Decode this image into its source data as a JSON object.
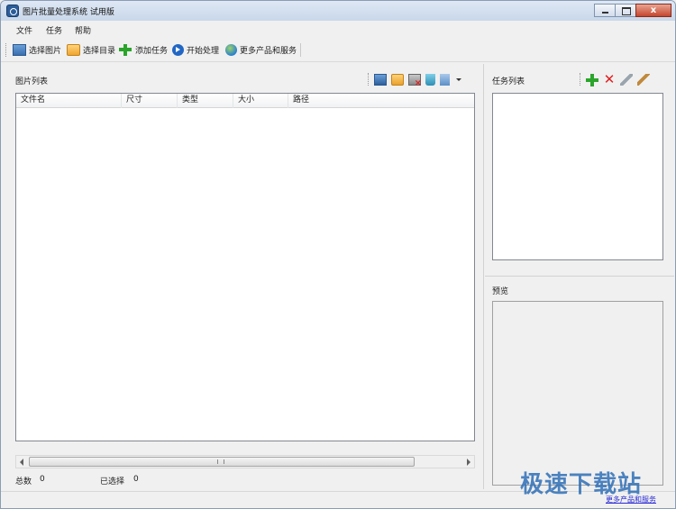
{
  "window": {
    "title": "图片批量处理系统 试用版",
    "controls": {
      "minimize": "",
      "maximize": "",
      "close": "x"
    }
  },
  "menu": [
    "文件",
    "任务",
    "帮助"
  ],
  "toolbar": {
    "items": [
      {
        "label": "选择图片",
        "icon": "image-icon"
      },
      {
        "label": "选择目录",
        "icon": "folder-icon"
      },
      {
        "label": "添加任务",
        "icon": "plus-icon"
      },
      {
        "label": "开始处理",
        "icon": "play-icon"
      },
      {
        "label": "更多产品和服务",
        "icon": "globe-icon"
      }
    ]
  },
  "left": {
    "title": "图片列表",
    "columns": [
      "文件名",
      "尺寸",
      "类型",
      "大小",
      "路径"
    ],
    "rows": [],
    "total_label": "总数",
    "total_value": "0",
    "selected_label": "已选择",
    "selected_value": "0"
  },
  "right": {
    "task_title": "任务列表",
    "preview_title": "预览"
  },
  "status": {
    "link": "更多产品和服务"
  },
  "watermark": "极速下载站"
}
